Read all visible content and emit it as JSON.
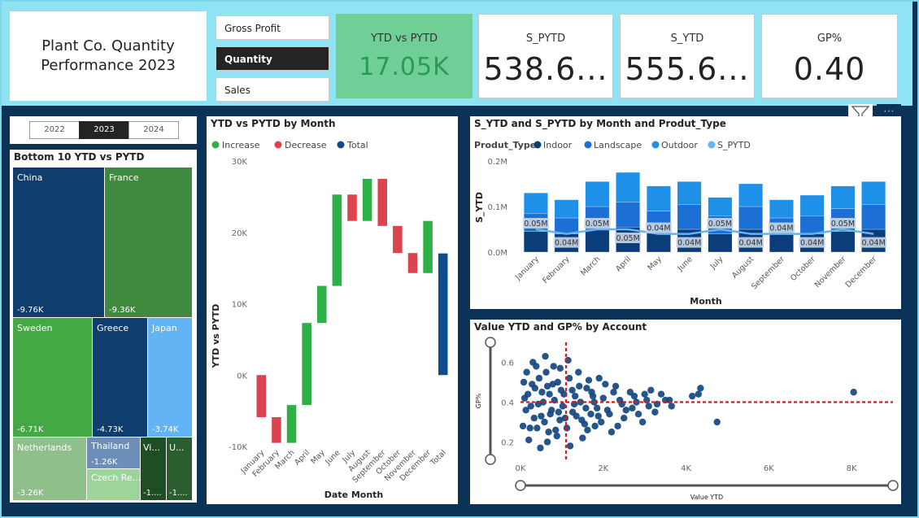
{
  "header": {
    "title": "Plant Co. Quantity Performance 2023",
    "buttons": [
      "Gross Profit",
      "Quantity",
      "Sales"
    ],
    "active_button": "Quantity"
  },
  "kpis": [
    {
      "label": "YTD vs PYTD",
      "value": "17.05K"
    },
    {
      "label": "S_PYTD",
      "value": "538.6..."
    },
    {
      "label": "S_YTD",
      "value": "555.6..."
    },
    {
      "label": "GP%",
      "value": "0.40"
    }
  ],
  "years": {
    "items": [
      "2022",
      "2023",
      "2024"
    ],
    "selected": "2023"
  },
  "colors": {
    "increase": "#2db045",
    "decrease": "#d9444f",
    "total": "#0f4c8c",
    "indoor": "#0b3d7a",
    "landscape": "#1c6fd4",
    "outdoor": "#1e90e8",
    "s_pytd": "#62b4f5"
  },
  "icons": {
    "filter": "filter-icon",
    "more": "more-options-icon"
  },
  "treemap": {
    "title": "Bottom 10 YTD vs PYTD",
    "items": [
      {
        "name": "China",
        "value": "-9.76K",
        "color": "#0e3d6e"
      },
      {
        "name": "France",
        "value": "-9.36K",
        "color": "#3f8a3f"
      },
      {
        "name": "Sweden",
        "value": "-6.71K",
        "color": "#44a845"
      },
      {
        "name": "Greece",
        "value": "-4.73K",
        "color": "#0e3d6e"
      },
      {
        "name": "Japan",
        "value": "-3.74K",
        "color": "#62b4f5"
      },
      {
        "name": "Netherlands",
        "value": "-3.26K",
        "color": "#8fbf8a"
      },
      {
        "name": "Thailand",
        "value": "-1.26K",
        "color": "#6b8fb8"
      },
      {
        "name": "Czech Re...",
        "value": "",
        "color": "#9cd49a"
      },
      {
        "name": "Vi...",
        "value": "-1....",
        "color": "#1f4d24"
      },
      {
        "name": "U...",
        "value": "-1....",
        "color": "#2b5e2e"
      }
    ]
  },
  "chart_data": [
    {
      "type": "bar",
      "subtype": "waterfall",
      "title": "YTD vs PYTD by Month",
      "legend": [
        "Increase",
        "Decrease",
        "Total"
      ],
      "xlabel": "Date Month",
      "ylabel": "YTD vs PYTD",
      "ylim": [
        -10000,
        30000
      ],
      "yticks": [
        "30K",
        "20K",
        "10K",
        "0K",
        "-10K"
      ],
      "categories": [
        "January",
        "February",
        "March",
        "April",
        "May",
        "June",
        "July",
        "August",
        "September",
        "October",
        "November",
        "December",
        "Total"
      ],
      "values": [
        -5900,
        -3600,
        5300,
        11500,
        5200,
        12800,
        -3700,
        5900,
        -6600,
        -3800,
        -2800,
        7300,
        17050
      ]
    },
    {
      "type": "bar",
      "subtype": "stacked-bar-with-line",
      "title": "S_YTD and S_PYTD by Month and Produt_Type",
      "legend_title": "Produt_Type",
      "legend": [
        "Indoor",
        "Landscape",
        "Outdoor",
        "S_PYTD"
      ],
      "xlabel": "Month",
      "ylabel": "S_YTD",
      "ylim": [
        0,
        0.2
      ],
      "yticks": [
        "0.2M",
        "0.1M",
        "0.0M"
      ],
      "categories": [
        "January",
        "February",
        "March",
        "April",
        "May",
        "June",
        "July",
        "August",
        "September",
        "October",
        "November",
        "December"
      ],
      "series": [
        {
          "name": "Indoor",
          "values": [
            0.045,
            0.04,
            0.05,
            0.055,
            0.045,
            0.05,
            0.04,
            0.05,
            0.04,
            0.04,
            0.045,
            0.05
          ]
        },
        {
          "name": "Landscape",
          "values": [
            0.04,
            0.035,
            0.05,
            0.055,
            0.045,
            0.055,
            0.04,
            0.05,
            0.035,
            0.04,
            0.05,
            0.055
          ]
        },
        {
          "name": "Outdoor",
          "values": [
            0.045,
            0.04,
            0.055,
            0.065,
            0.055,
            0.05,
            0.04,
            0.05,
            0.04,
            0.045,
            0.05,
            0.05
          ]
        },
        {
          "name": "S_PYTD",
          "values": [
            0.05,
            0.04,
            0.05,
            0.05,
            0.04,
            0.04,
            0.05,
            0.04,
            0.04,
            0.04,
            0.05,
            0.04
          ]
        }
      ],
      "data_labels": [
        "0.05M",
        "0.04M",
        "0.05M",
        "0.05M",
        "0.04M",
        "0.04M",
        "0.05M",
        "0.04M",
        "0.04M",
        "0.04M",
        "0.05M",
        "0.04M"
      ]
    },
    {
      "type": "scatter",
      "title": "Value YTD and GP% by Account",
      "xlabel": "Value YTD",
      "ylabel": "GP%",
      "xlim": [
        0,
        9000
      ],
      "ylim": [
        0.1,
        0.7
      ],
      "xticks": [
        "0K",
        "2K",
        "4K",
        "6K",
        "8K"
      ],
      "yticks": [
        "0.6",
        "0.4",
        "0.2"
      ],
      "ref_x": 1100,
      "ref_y": 0.4,
      "points": [
        [
          8050,
          0.45
        ],
        [
          4350,
          0.47
        ],
        [
          4300,
          0.44
        ],
        [
          4150,
          0.43
        ],
        [
          4750,
          0.3
        ],
        [
          3100,
          0.38
        ],
        [
          3000,
          0.44
        ],
        [
          2800,
          0.4
        ],
        [
          3250,
          0.35
        ],
        [
          2950,
          0.3
        ],
        [
          3500,
          0.41
        ],
        [
          3650,
          0.38
        ],
        [
          2500,
          0.32
        ],
        [
          2650,
          0.45
        ],
        [
          2300,
          0.48
        ],
        [
          2200,
          0.25
        ],
        [
          2100,
          0.36
        ],
        [
          2400,
          0.41
        ],
        [
          2700,
          0.37
        ],
        [
          1900,
          0.52
        ],
        [
          1800,
          0.28
        ],
        [
          2000,
          0.42
        ],
        [
          1700,
          0.34
        ],
        [
          1600,
          0.47
        ],
        [
          1500,
          0.22
        ],
        [
          1400,
          0.55
        ],
        [
          1300,
          0.39
        ],
        [
          1200,
          0.18
        ],
        [
          1150,
          0.61
        ],
        [
          1050,
          0.44
        ],
        [
          950,
          0.31
        ],
        [
          900,
          0.5
        ],
        [
          850,
          0.26
        ],
        [
          800,
          0.58
        ],
        [
          750,
          0.36
        ],
        [
          700,
          0.44
        ],
        [
          650,
          0.2
        ],
        [
          600,
          0.63
        ],
        [
          550,
          0.4
        ],
        [
          500,
          0.33
        ],
        [
          450,
          0.52
        ],
        [
          400,
          0.27
        ],
        [
          350,
          0.47
        ],
        [
          300,
          0.6
        ],
        [
          250,
          0.38
        ],
        [
          200,
          0.21
        ],
        [
          150,
          0.55
        ],
        [
          100,
          0.42
        ],
        [
          1250,
          0.46
        ],
        [
          1350,
          0.33
        ],
        [
          1450,
          0.4
        ],
        [
          1550,
          0.29
        ],
        [
          1650,
          0.51
        ],
        [
          1750,
          0.43
        ],
        [
          1850,
          0.37
        ],
        [
          1950,
          0.3
        ],
        [
          2050,
          0.49
        ],
        [
          2150,
          0.34
        ],
        [
          2250,
          0.45
        ],
        [
          2350,
          0.28
        ],
        [
          2450,
          0.39
        ],
        [
          2550,
          0.36
        ],
        [
          2750,
          0.43
        ],
        [
          2850,
          0.34
        ],
        [
          3050,
          0.41
        ],
        [
          3150,
          0.46
        ],
        [
          3300,
          0.39
        ],
        [
          3400,
          0.44
        ],
        [
          3600,
          0.41
        ],
        [
          650,
          0.48
        ],
        [
          720,
          0.34
        ],
        [
          880,
          0.23
        ],
        [
          960,
          0.57
        ],
        [
          1020,
          0.38
        ],
        [
          1120,
          0.27
        ],
        [
          1180,
          0.52
        ],
        [
          1260,
          0.35
        ],
        [
          1320,
          0.43
        ],
        [
          1420,
          0.48
        ],
        [
          1480,
          0.31
        ],
        [
          1580,
          0.37
        ],
        [
          1620,
          0.26
        ],
        [
          1720,
          0.45
        ],
        [
          1780,
          0.4
        ],
        [
          1880,
          0.33
        ],
        [
          520,
          0.45
        ],
        [
          580,
          0.3
        ],
        [
          620,
          0.55
        ],
        [
          680,
          0.25
        ],
        [
          780,
          0.49
        ],
        [
          820,
          0.41
        ],
        [
          920,
          0.35
        ],
        [
          980,
          0.46
        ],
        [
          1080,
          0.32
        ],
        [
          430,
          0.39
        ],
        [
          480,
          0.17
        ],
        [
          380,
          0.58
        ],
        [
          330,
          0.32
        ],
        [
          280,
          0.49
        ],
        [
          230,
          0.27
        ],
        [
          180,
          0.44
        ],
        [
          130,
          0.36
        ],
        [
          80,
          0.5
        ],
        [
          60,
          0.28
        ]
      ]
    }
  ]
}
